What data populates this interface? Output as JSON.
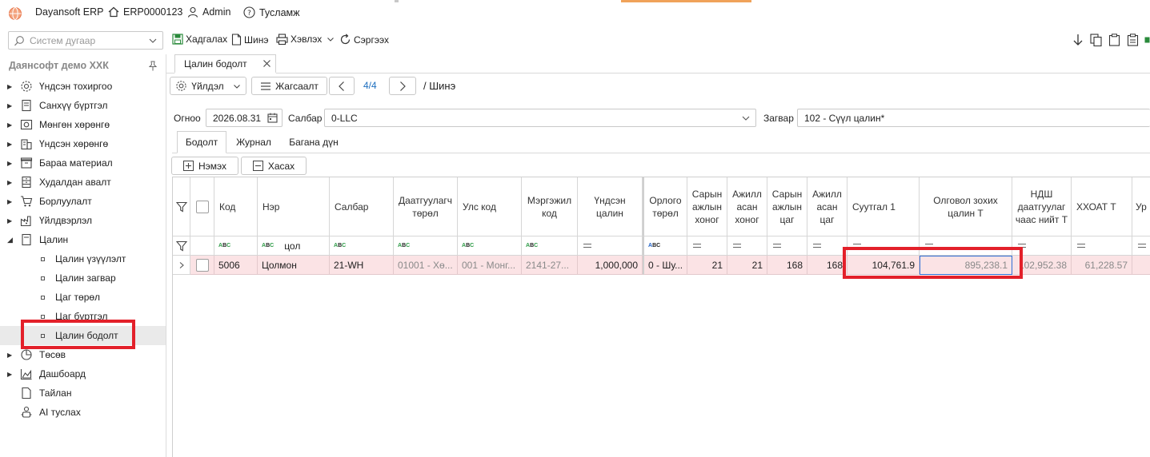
{
  "app": {
    "name": "Dayansoft ERP",
    "doc_code": "ERP0000123",
    "user": "Admin",
    "help": "Тусламж"
  },
  "toolbar": {
    "search_placeholder": "Систем дугаар",
    "save": "Хадгалах",
    "new": "Шинэ",
    "print": "Хэвлэх",
    "refresh": "Сэргээх"
  },
  "sidebar": {
    "company": "Даянсофт демо ХХК",
    "items": [
      {
        "label": "Үндсэн тохиргоо",
        "icon": "gear-icon"
      },
      {
        "label": "Санхүү бүртгэл",
        "icon": "ledger-icon"
      },
      {
        "label": "Мөнгөн хөрөнгө",
        "icon": "cash-icon"
      },
      {
        "label": "Үндсэн хөрөнгө",
        "icon": "building-icon"
      },
      {
        "label": "Бараа материал",
        "icon": "box-icon"
      },
      {
        "label": "Худалдан авалт",
        "icon": "cabinet-icon"
      },
      {
        "label": "Борлуулалт",
        "icon": "cart-icon"
      },
      {
        "label": "Үйлдвэрлэл",
        "icon": "factory-icon"
      },
      {
        "label": "Цалин",
        "icon": "wallet-icon"
      }
    ],
    "sub_items": [
      {
        "label": "Цалин үзүүлэлт"
      },
      {
        "label": "Цалин загвар"
      },
      {
        "label": "Цаг төрөл"
      },
      {
        "label": "Цаг бүртгэл"
      },
      {
        "label": "Цалин бодолт"
      }
    ],
    "bottom_items": [
      {
        "label": "Төсөв",
        "icon": "pie-icon"
      },
      {
        "label": "Дашбоард",
        "icon": "chart-icon"
      },
      {
        "label": "Тайлан",
        "icon": "report-icon"
      },
      {
        "label": "AI туслах",
        "icon": "assistant-icon"
      }
    ]
  },
  "document_tab": {
    "title": "Цалин бодолт"
  },
  "nav": {
    "action": "Үйлдэл",
    "list": "Жагсаалт",
    "position": "4/4",
    "status": "/ Шинэ"
  },
  "filters": {
    "date_label": "Огноо",
    "date_value": "2026.08.31",
    "branch_label": "Салбар",
    "branch_value": "0-LLC",
    "template_label": "Загвар",
    "template_value": "102 - Сүүл цалин*"
  },
  "sub_tabs": [
    "Бодолт",
    "Журнал",
    "Багана дүн"
  ],
  "actions": {
    "add": "Нэмэх",
    "remove": "Хасах"
  },
  "grid": {
    "columns": [
      "Код",
      "Нэр",
      "Салбар",
      "Даатгуулагч төрөл",
      "Улс код",
      "Мэргэжил код",
      "Үндсэн цалин",
      "Орлого төрөл",
      "Сарын ажлын хоног",
      "Ажилл асан хоног",
      "Сарын ажлын цаг",
      "Ажилл асан цаг",
      "Суутгал 1",
      "Олговол зохих цалин Т",
      "НДШ даатгуулаг чаас нийт Т",
      "ХХОАТ Т",
      "Ур"
    ],
    "filter_name_value": "цол",
    "rows": [
      {
        "code": "5006",
        "name": "Цолмон",
        "branch": "21-WH",
        "insured_type": "01001 - Хө...",
        "country_code": "001 - Монг...",
        "profession_code": "2141-27...",
        "base_salary": "1,000,000",
        "income_type": "0 - Шу...",
        "month_days": "21",
        "worked_days": "21",
        "month_hours": "168",
        "worked_hours": "168",
        "deduction1": "104,761.9",
        "payable": "895,238.1",
        "social_insurance": "102,952.38",
        "pit": "61,228.57"
      }
    ]
  }
}
